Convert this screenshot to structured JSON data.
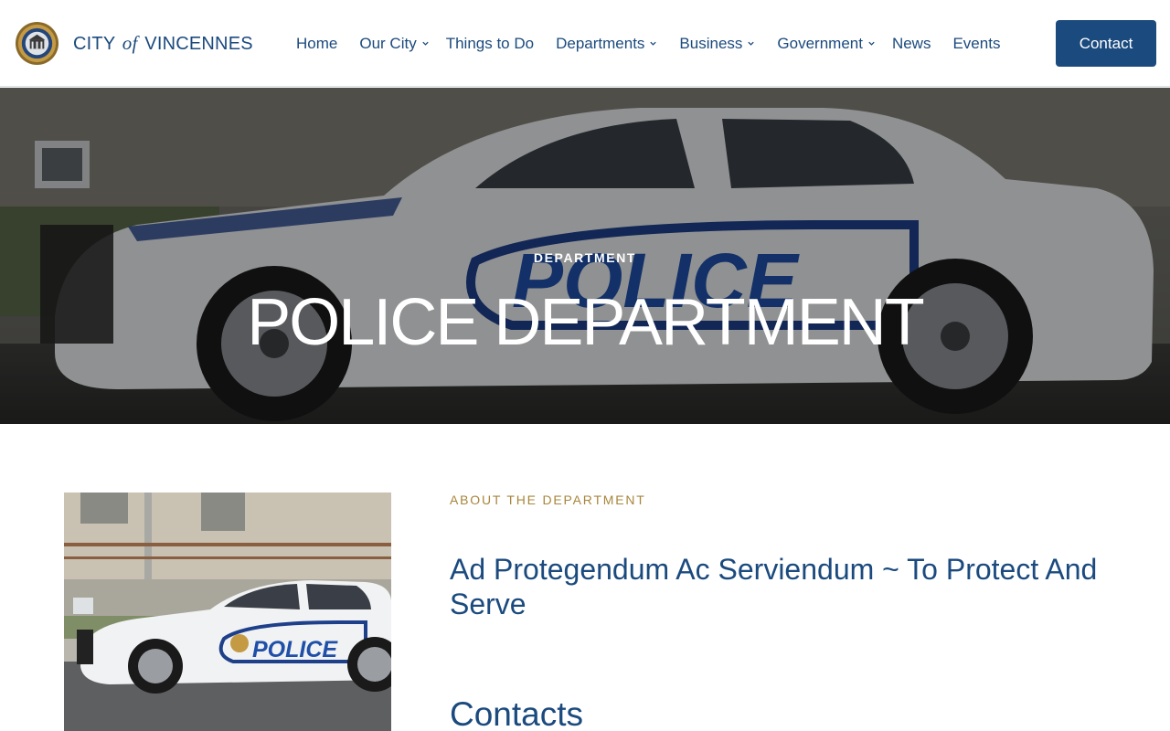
{
  "site": {
    "logo_pre": "CITY",
    "logo_of": "of",
    "logo_post": "VINCENNES"
  },
  "nav": [
    {
      "label": "Home",
      "dropdown": false
    },
    {
      "label": "Our City",
      "dropdown": true
    },
    {
      "label": "Things to Do",
      "dropdown": false
    },
    {
      "label": "Departments",
      "dropdown": true
    },
    {
      "label": "Business",
      "dropdown": true
    },
    {
      "label": "Government",
      "dropdown": true
    },
    {
      "label": "News",
      "dropdown": false
    },
    {
      "label": "Events",
      "dropdown": false
    }
  ],
  "contact_label": "Contact",
  "hero": {
    "eyebrow": "DEPARTMENT",
    "title": "POLICE DEPARTMENT"
  },
  "about": {
    "eyebrow": "ABOUT THE DEPARTMENT",
    "headline": "Ad Protegendum Ac Serviendum ~ To Protect And Serve",
    "contacts_heading": "Contacts"
  },
  "car_decal": "POLICE",
  "colors": {
    "brand": "#1b4a7e",
    "accent": "#a8853b"
  },
  "icons": {
    "seal": "city-seal-icon",
    "chevron": "chevron-down-icon"
  }
}
